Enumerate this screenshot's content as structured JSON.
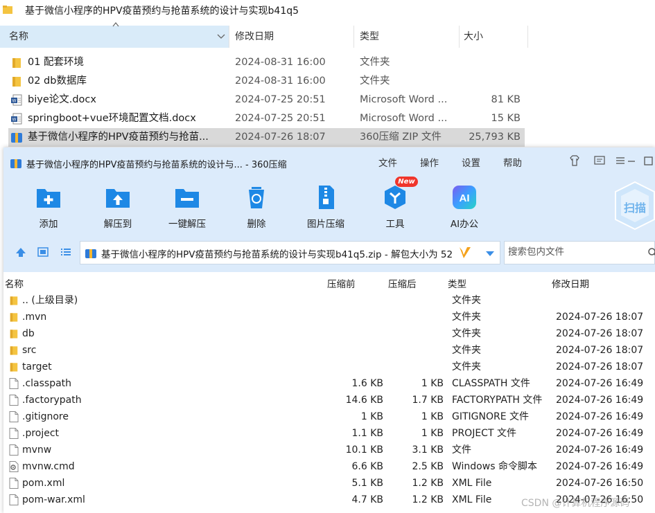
{
  "explorer": {
    "title": "基于微信小程序的HPV疫苗预约与抢苗系统的设计与实现b41q5",
    "columns": {
      "name": "名称",
      "modified": "修改日期",
      "type": "类型",
      "size": "大小"
    },
    "rows": [
      {
        "name": "01 配套环境",
        "modified": "2024-08-31 16:00",
        "type": "文件夹",
        "size": "",
        "icon": "folder-icon"
      },
      {
        "name": "02 db数据库",
        "modified": "2024-08-31 16:00",
        "type": "文件夹",
        "size": "",
        "icon": "folder-icon"
      },
      {
        "name": "biye论文.docx",
        "modified": "2024-07-25 20:51",
        "type": "Microsoft Word ...",
        "size": "81 KB",
        "icon": "word-doc-icon"
      },
      {
        "name": "springboot+vue环境配置文档.docx",
        "modified": "2024-07-25 20:51",
        "type": "Microsoft Word ...",
        "size": "15 KB",
        "icon": "word-doc-icon"
      },
      {
        "name": "基于微信小程序的HPV疫苗预约与抢苗...",
        "modified": "2024-07-26 18:07",
        "type": "360压缩 ZIP 文件",
        "size": "25,793 KB",
        "icon": "zip-archive-icon",
        "selected": true
      }
    ]
  },
  "zip": {
    "title": "基于微信小程序的HPV疫苗预约与抢苗系统的设计与... - 360压缩",
    "menu": [
      "文件",
      "操作",
      "设置",
      "帮助"
    ],
    "toolbar": [
      {
        "label": "添加",
        "icon": "add-folder-icon"
      },
      {
        "label": "解压到",
        "icon": "extract-to-icon"
      },
      {
        "label": "一键解压",
        "icon": "one-click-extract-icon"
      },
      {
        "label": "删除",
        "icon": "recycle-bin-icon"
      },
      {
        "label": "图片压缩",
        "icon": "image-compress-icon"
      },
      {
        "label": "工具",
        "icon": "tools-icon"
      },
      {
        "label": "AI办公",
        "icon": "ai-office-icon"
      }
    ],
    "new_badge": "New",
    "scan_label": "扫描",
    "path": "基于微信小程序的HPV疫苗预约与抢苗系统的设计与实现b41q5.zip - 解包大小为 52",
    "search_placeholder": "搜索包内文件",
    "columns": {
      "name": "名称",
      "before": "压缩前",
      "after": "压缩后",
      "type": "类型",
      "modified": "修改日期"
    },
    "rows": [
      {
        "name": ".. (上级目录)",
        "before": "",
        "after": "",
        "type": "文件夹",
        "modified": "",
        "icon": "folder-icon"
      },
      {
        "name": ".mvn",
        "before": "",
        "after": "",
        "type": "文件夹",
        "modified": "2024-07-26 18:07",
        "icon": "folder-icon"
      },
      {
        "name": "db",
        "before": "",
        "after": "",
        "type": "文件夹",
        "modified": "2024-07-26 18:07",
        "icon": "folder-icon"
      },
      {
        "name": "src",
        "before": "",
        "after": "",
        "type": "文件夹",
        "modified": "2024-07-26 18:07",
        "icon": "folder-icon"
      },
      {
        "name": "target",
        "before": "",
        "after": "",
        "type": "文件夹",
        "modified": "2024-07-26 18:07",
        "icon": "folder-icon"
      },
      {
        "name": ".classpath",
        "before": "1.6 KB",
        "after": "1 KB",
        "type": "CLASSPATH 文件",
        "modified": "2024-07-26 16:49",
        "icon": "file-icon"
      },
      {
        "name": ".factorypath",
        "before": "14.6 KB",
        "after": "1.7 KB",
        "type": "FACTORYPATH 文件",
        "modified": "2024-07-26 16:49",
        "icon": "file-icon"
      },
      {
        "name": ".gitignore",
        "before": "1 KB",
        "after": "1 KB",
        "type": "GITIGNORE 文件",
        "modified": "2024-07-26 16:49",
        "icon": "file-icon"
      },
      {
        "name": ".project",
        "before": "1.1 KB",
        "after": "1 KB",
        "type": "PROJECT 文件",
        "modified": "2024-07-26 16:49",
        "icon": "file-icon"
      },
      {
        "name": "mvnw",
        "before": "10.1 KB",
        "after": "3.1 KB",
        "type": "文件",
        "modified": "2024-07-26 16:49",
        "icon": "file-icon"
      },
      {
        "name": "mvnw.cmd",
        "before": "6.6 KB",
        "after": "2.5 KB",
        "type": "Windows 命令脚本",
        "modified": "2024-07-26 16:49",
        "icon": "cmd-script-icon"
      },
      {
        "name": "pom.xml",
        "before": "5.1 KB",
        "after": "1.2 KB",
        "type": "XML File",
        "modified": "2024-07-26 16:50",
        "icon": "file-icon"
      },
      {
        "name": "pom-war.xml",
        "before": "4.7 KB",
        "after": "1.2 KB",
        "type": "XML File",
        "modified": "2024-07-26 16:50",
        "icon": "file-icon"
      }
    ]
  },
  "watermark": "CSDN @计算机程序源码",
  "colors": {
    "accent": "#1e88e5",
    "zip_top_bg": "#dcebfb",
    "selected_row": "#d9d9d9",
    "new_badge": "#f0352b"
  }
}
